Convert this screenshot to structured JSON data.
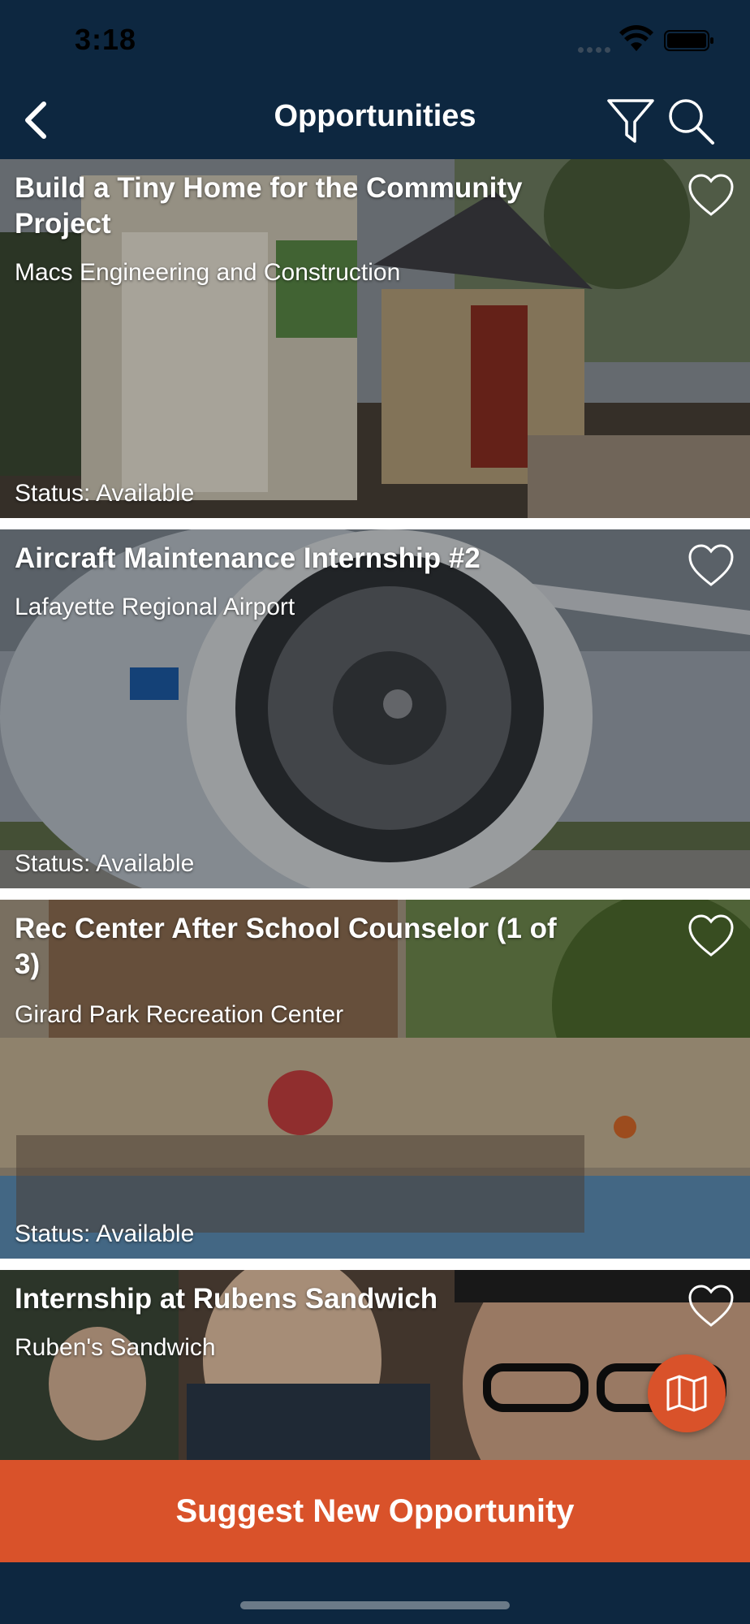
{
  "status_bar": {
    "time": "3:18"
  },
  "nav": {
    "title": "Opportunities",
    "back_icon": "chevron-left-icon",
    "filter_icon": "filter-icon",
    "search_icon": "search-icon"
  },
  "cards": [
    {
      "title": "Build a Tiny Home for the Community Project",
      "organization": "Macs Engineering and Construction",
      "status": "Status: Available",
      "favorite_icon": "heart-outline-icon",
      "favorited": false
    },
    {
      "title": "Aircraft Maintenance Internship #2",
      "organization": "Lafayette Regional Airport",
      "status": "Status: Available",
      "favorite_icon": "heart-outline-icon",
      "favorited": false
    },
    {
      "title": "Rec Center After School Counselor (1 of 3)",
      "organization": "Girard Park Recreation Center",
      "status": "Status: Available",
      "favorite_icon": "heart-outline-icon",
      "favorited": false
    },
    {
      "title": "Internship at Rubens Sandwich",
      "organization": "Ruben's Sandwich",
      "favorite_icon": "heart-outline-icon",
      "favorited": false
    }
  ],
  "map_button": {
    "icon": "map-icon"
  },
  "suggest_button": {
    "label": "Suggest New Opportunity"
  },
  "colors": {
    "nav_background": "#0d2740",
    "accent": "#d9522a",
    "text": "#ffffff"
  }
}
